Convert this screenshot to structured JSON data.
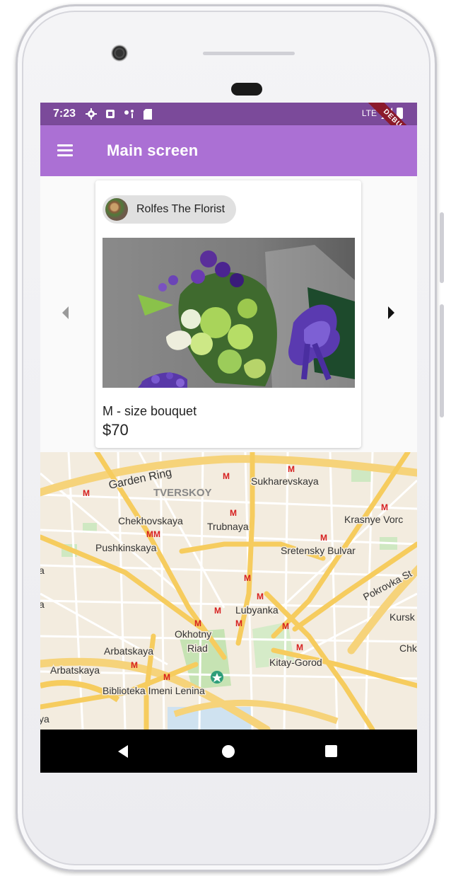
{
  "status_bar": {
    "time": "7:23",
    "network": "LTE",
    "debug_banner": "DEBUG"
  },
  "app_bar": {
    "title": "Main screen",
    "menu_icon": "hamburger-menu-icon"
  },
  "card": {
    "seller_chip": "Rolfes The Florist",
    "product_name": "M - size bouquet",
    "product_price": "$70"
  },
  "carousel": {
    "prev_icon": "arrow-left-icon",
    "next_icon": "arrow-right-icon"
  },
  "map": {
    "labels": {
      "garden_ring": "Garden Ring",
      "tverskoy": "TVERSKOY",
      "sukharevskaya": "Sukharevskaya",
      "chekhovskaya": "Chekhovskaya",
      "trubnaya": "Trubnaya",
      "krasnye_vorota": "Krasnye Vorc",
      "pushkinskaya": "Pushkinskaya",
      "sretensky_bulvar": "Sretensky Bulvar",
      "pokrovka": "Pokrovka St",
      "lubyanka": "Lubyanka",
      "kursk": "Kursk",
      "okhotny": "Okhotny",
      "riad": "Riad",
      "chk": "Chk",
      "arbatskaya_1": "Arbatskaya",
      "arbatskaya_2": "Arbatskaya",
      "kitay_gorod": "Kitay-Gorod",
      "biblioteka": "Biblioteka Imeni Lenina",
      "edge_a1": "a",
      "edge_a2": "a",
      "edge_ya": "ya"
    },
    "metro_glyph": "M"
  },
  "colors": {
    "status_bar": "#7b4a9a",
    "app_bar": "#ab70d4",
    "metro": "#d61f1f",
    "road_major": "#f6d37a",
    "road_minor": "#ffffff"
  }
}
